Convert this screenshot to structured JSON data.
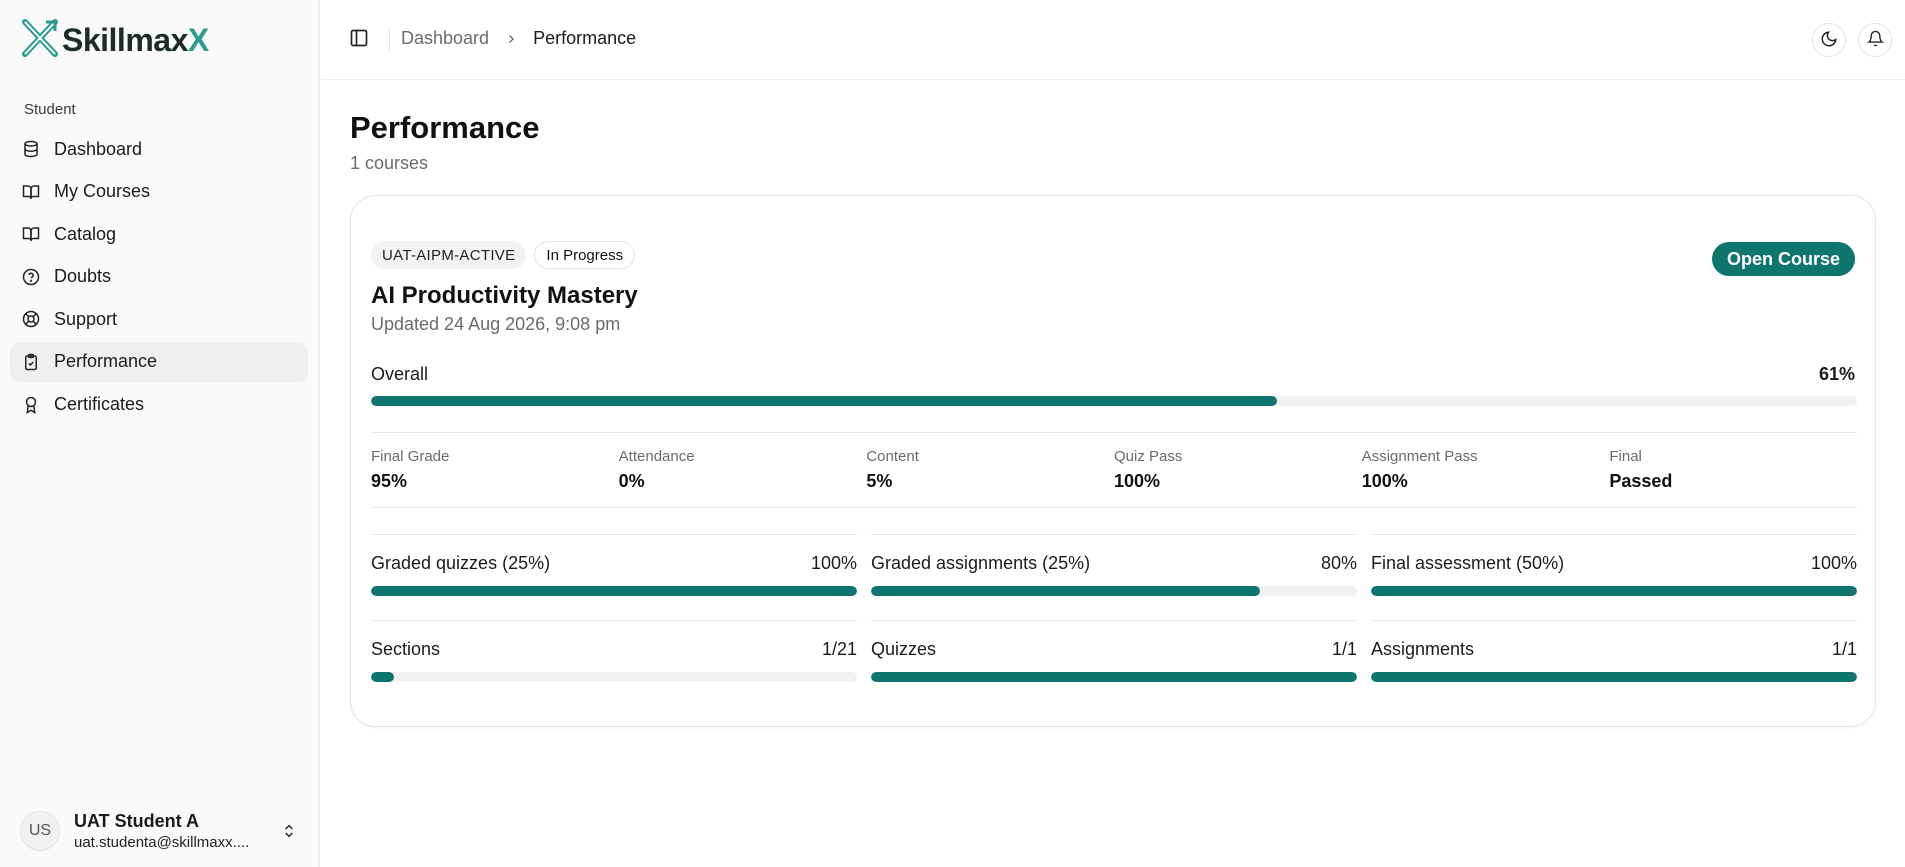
{
  "app": {
    "logo_main": "Skillmax",
    "logo_accent": "X",
    "logo_icon": "skillmaxx-logo-icon"
  },
  "sidebar": {
    "group_label": "Student",
    "items": [
      {
        "label": "Dashboard",
        "icon": "database-icon"
      },
      {
        "label": "My Courses",
        "icon": "book-open-icon"
      },
      {
        "label": "Catalog",
        "icon": "book-icon"
      },
      {
        "label": "Doubts",
        "icon": "question-circle-icon"
      },
      {
        "label": "Support",
        "icon": "life-buoy-icon"
      },
      {
        "label": "Performance",
        "icon": "clipboard-check-icon",
        "active": true
      },
      {
        "label": "Certificates",
        "icon": "award-icon"
      }
    ],
    "user": {
      "initials": "US",
      "name": "UAT Student A",
      "email": "uat.studenta@skillmaxx...."
    }
  },
  "header": {
    "breadcrumb": {
      "parent": "Dashboard",
      "current": "Performance"
    }
  },
  "main": {
    "title": "Performance",
    "subtitle": "1 courses",
    "course": {
      "code": "UAT-AIPM-ACTIVE",
      "status": "In Progress",
      "title": "AI Productivity Mastery",
      "updated": "Updated 24 Aug 2026, 9:08 pm",
      "open_label": "Open Course",
      "overall": {
        "label": "Overall",
        "value": "61%",
        "fraction": 0.61
      },
      "stats": [
        {
          "label": "Final Grade",
          "value": "95%"
        },
        {
          "label": "Attendance",
          "value": "0%"
        },
        {
          "label": "Content",
          "value": "5%"
        },
        {
          "label": "Quiz Pass",
          "value": "100%"
        },
        {
          "label": "Assignment Pass",
          "value": "100%"
        },
        {
          "label": "Final",
          "value": "Passed"
        }
      ],
      "weights": [
        {
          "label": "Graded quizzes (25%)",
          "value": "100%",
          "fraction": 1.0
        },
        {
          "label": "Graded assignments (25%)",
          "value": "80%",
          "fraction": 0.8
        },
        {
          "label": "Final assessment (50%)",
          "value": "100%",
          "fraction": 1.0
        }
      ],
      "progress": [
        {
          "label": "Sections",
          "value": "1/21",
          "fraction": 0.0476
        },
        {
          "label": "Quizzes",
          "value": "1/1",
          "fraction": 1.0
        },
        {
          "label": "Assignments",
          "value": "1/1",
          "fraction": 1.0
        }
      ]
    }
  },
  "colors": {
    "accent": "#0f766e",
    "logo_accent": "#2a9d8f",
    "track": "#f1f1f1"
  }
}
